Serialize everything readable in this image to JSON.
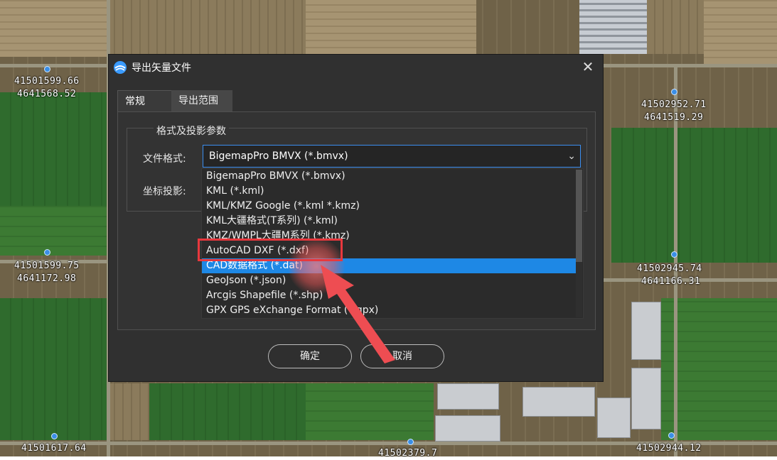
{
  "map": {
    "coords": [
      {
        "line1": "41501599.66",
        "line2": "4641568.52"
      },
      {
        "line1": "41502952.71",
        "line2": "4641519.29"
      },
      {
        "line1": "41501599.75",
        "line2": "4641172.98"
      },
      {
        "line1": "41502945.74",
        "line2": "4641166.31"
      },
      {
        "line1": "41501617.64",
        "line2": ""
      },
      {
        "line1": "41502379.7",
        "line2": ""
      },
      {
        "line1": "41502944.12",
        "line2": ""
      }
    ]
  },
  "dialog": {
    "title": "导出矢量文件",
    "close_glyph": "✕",
    "tabs": [
      {
        "label": "常规",
        "active": true
      },
      {
        "label": "导出范围",
        "active": false
      }
    ],
    "group_title": "格式及投影参数",
    "format_label": "文件格式:",
    "projection_label": "坐标投影:",
    "format_selected": "BigemapPro BMVX (*.bmvx)",
    "format_options": [
      "BigemapPro BMVX (*.bmvx)",
      "KML (*.kml)",
      "KML/KMZ Google (*.kml *.kmz)",
      "KML大疆格式(T系列) (*.kml)",
      "KMZ/WMPL大疆M系列 (*.kmz)",
      "AutoCAD DXF (*.dxf)",
      "CAD数据格式 (*.dat)",
      "GeoJson (*.json)",
      "Arcgis Shapefile (*.shp)",
      "GPX GPS eXchange Format (*.gpx)"
    ],
    "highlighted_option_index": 6,
    "ok_label": "确定",
    "cancel_label": "取消"
  },
  "colors": {
    "accent": "#1e88e5",
    "annotation_red": "#e8383d",
    "dialog_bg": "#303030"
  }
}
